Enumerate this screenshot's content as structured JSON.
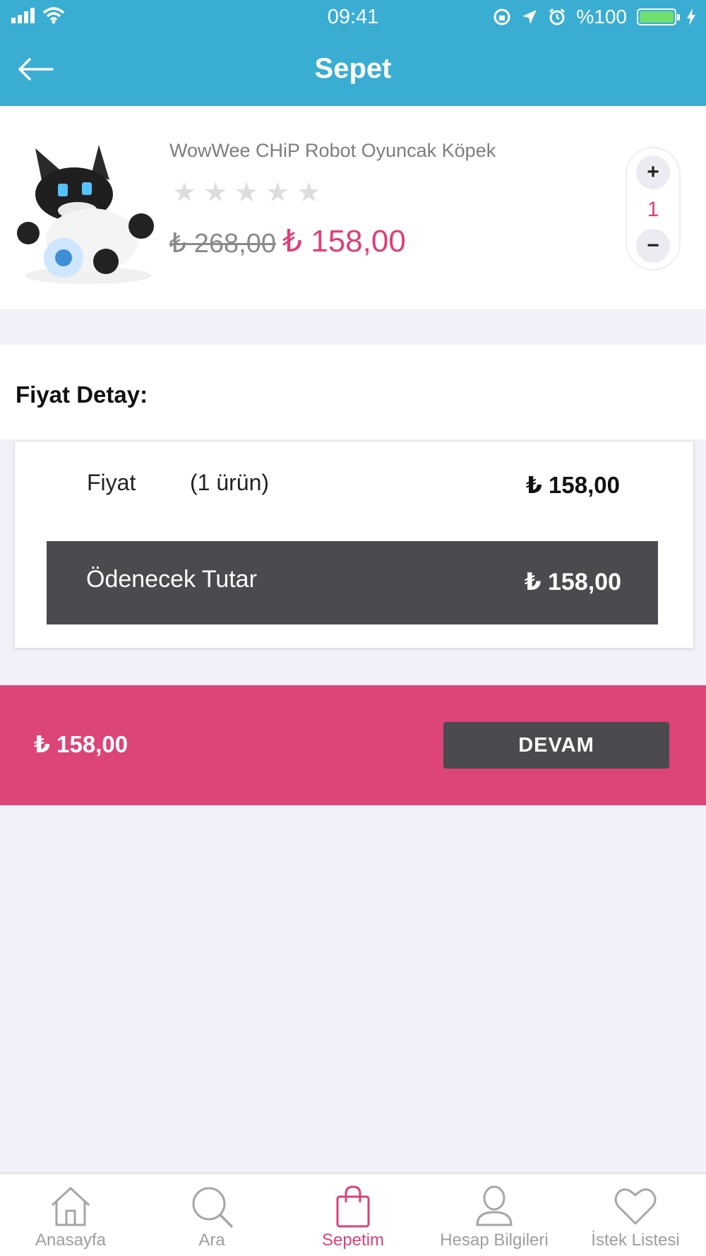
{
  "status_bar": {
    "time": "09:41",
    "battery": "%100"
  },
  "header": {
    "title": "Sepet"
  },
  "product": {
    "name": "WowWee CHiP Robot Oyuncak Köpek",
    "rating_stars": 5,
    "rating_value": 0,
    "old_price": "₺ 268,00",
    "new_price": "₺ 158,00",
    "quantity": "1",
    "plus_label": "+",
    "minus_label": "−"
  },
  "price_detail": {
    "title": "Fiyat Detay:",
    "price_label": "Fiyat",
    "item_count": "(1 ürün)",
    "price_value": "₺ 158,00",
    "total_label": "Ödenecek Tutar",
    "total_value": "₺ 158,00"
  },
  "checkout": {
    "total": "₺ 158,00",
    "button_label": "DEVAM"
  },
  "tabbar": {
    "items": [
      {
        "label": "Anasayfa",
        "icon": "home-icon"
      },
      {
        "label": "Ara",
        "icon": "search-icon"
      },
      {
        "label": "Sepetim",
        "icon": "shopping-bag-icon"
      },
      {
        "label": "Hesap Bilgileri",
        "icon": "user-icon"
      },
      {
        "label": "İstek Listesi",
        "icon": "heart-icon"
      }
    ],
    "active_index": 2
  },
  "colors": {
    "header": "#3aadd3",
    "accent": "#de3f78",
    "checkout_bar": "#dd4477",
    "dark": "#4b4a4e"
  }
}
